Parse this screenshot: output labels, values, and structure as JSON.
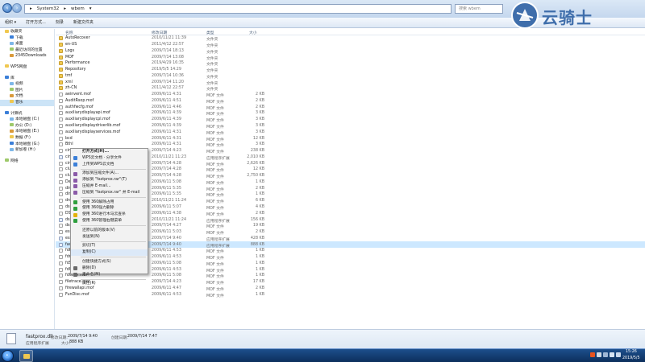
{
  "address": {
    "segments": [
      "System32",
      "wbem"
    ],
    "search_placeholder": "搜索 wbem"
  },
  "toolbar": {
    "items": [
      "组织 ▾",
      "打开方式...",
      "刻录",
      "新建文件夹"
    ]
  },
  "nav": {
    "favorites": [
      "收藏夹",
      "下载",
      "桌面",
      "最近访问的位置",
      "2345Downloads"
    ],
    "wps": "WPS网盘",
    "libraries": [
      "库",
      "视频",
      "图片",
      "文档",
      "音乐"
    ],
    "computer": [
      "计算机",
      "本地磁盘 (C:)",
      "办公 (D:)",
      "本地磁盘 (E:)",
      "数据 (F:)",
      "本地磁盘 (G:)",
      "新加卷 (H:)"
    ],
    "network": "网络",
    "selected_index": 10
  },
  "columns": {
    "name": "名称",
    "date": "修改日期",
    "type": "类型",
    "size": "大小"
  },
  "files": [
    {
      "name": "AutoRecover",
      "date": "2010/11/21 11:39",
      "type": "文件夹",
      "size": "",
      "kind": "folder"
    },
    {
      "name": "en-US",
      "date": "2011/4/12 22:57",
      "type": "文件夹",
      "size": "",
      "kind": "folder"
    },
    {
      "name": "Logs",
      "date": "2009/7/14 18:13",
      "type": "文件夹",
      "size": "",
      "kind": "folder"
    },
    {
      "name": "MOF",
      "date": "2009/7/14 13:08",
      "type": "文件夹",
      "size": "",
      "kind": "folder"
    },
    {
      "name": "Performance",
      "date": "2019/4/29 16:35",
      "type": "文件夹",
      "size": "",
      "kind": "folder"
    },
    {
      "name": "Repository",
      "date": "2019/5/5 14:29",
      "type": "文件夹",
      "size": "",
      "kind": "folder"
    },
    {
      "name": "tmf",
      "date": "2009/7/14 10:36",
      "type": "文件夹",
      "size": "",
      "kind": "folder"
    },
    {
      "name": "xml",
      "date": "2009/7/14 11:20",
      "type": "文件夹",
      "size": "",
      "kind": "folder"
    },
    {
      "name": "zh-CN",
      "date": "2011/4/12 22:57",
      "type": "文件夹",
      "size": "",
      "kind": "folder"
    },
    {
      "name": "aeinvent.mof",
      "date": "2009/6/11 4:31",
      "type": "MOF 文件",
      "size": "2 KB",
      "kind": "file"
    },
    {
      "name": "AuditRsop.mof",
      "date": "2009/6/11 4:51",
      "type": "MOF 文件",
      "size": "2 KB",
      "kind": "file"
    },
    {
      "name": "authfwcfg.mof",
      "date": "2009/6/11 4:46",
      "type": "MOF 文件",
      "size": "2 KB",
      "kind": "file"
    },
    {
      "name": "auxiliarydisplayapi.mof",
      "date": "2009/6/11 4:39",
      "type": "MOF 文件",
      "size": "3 KB",
      "kind": "file"
    },
    {
      "name": "auxiliarydisplaycpl.mof",
      "date": "2009/6/11 4:39",
      "type": "MOF 文件",
      "size": "3 KB",
      "kind": "file"
    },
    {
      "name": "auxiliarydisplaydriverlib.mof",
      "date": "2009/6/11 4:39",
      "type": "MOF 文件",
      "size": "3 KB",
      "kind": "file"
    },
    {
      "name": "auxiliarydisplayservices.mof",
      "date": "2009/6/11 4:31",
      "type": "MOF 文件",
      "size": "3 KB",
      "kind": "file"
    },
    {
      "name": "bcd",
      "date": "2009/6/11 4:31",
      "type": "MOF 文件",
      "size": "12 KB",
      "kind": "file"
    },
    {
      "name": "BthI",
      "date": "2009/6/11 4:31",
      "type": "MOF 文件",
      "size": "3 KB",
      "kind": "file"
    },
    {
      "name": "cim",
      "date": "2009/7/14 4:23",
      "type": "MOF 文件",
      "size": "238 KB",
      "kind": "file"
    },
    {
      "name": "cim",
      "date": "2010/11/21 11:23",
      "type": "应用程序扩展",
      "size": "2,010 KB",
      "kind": "dll"
    },
    {
      "name": "cim",
      "date": "2009/7/14 4:28",
      "type": "MOF 文件",
      "size": "2,626 KB",
      "kind": "file"
    },
    {
      "name": "clus",
      "date": "2009/7/14 4:28",
      "type": "MOF 文件",
      "size": "12 KB",
      "kind": "file"
    },
    {
      "name": "clus",
      "date": "2009/7/14 4:28",
      "type": "MOF 文件",
      "size": "2,750 KB",
      "kind": "file"
    },
    {
      "name": "Des",
      "date": "2009/6/11 5:08",
      "type": "MOF 文件",
      "size": "1 KB",
      "kind": "file"
    },
    {
      "name": "dim",
      "date": "2009/6/11 5:35",
      "type": "MOF 文件",
      "size": "2 KB",
      "kind": "file"
    },
    {
      "name": "dim",
      "date": "2009/6/11 5:35",
      "type": "MOF 文件",
      "size": "1 KB",
      "kind": "file"
    },
    {
      "name": "dnt",
      "date": "2010/11/21 11:24",
      "type": "MOF 文件",
      "size": "6 KB",
      "kind": "file"
    },
    {
      "name": "dsn",
      "date": "2009/6/11 5:07",
      "type": "MOF 文件",
      "size": "4 KB",
      "kind": "file"
    },
    {
      "name": "DSN",
      "date": "2009/6/11 4:38",
      "type": "MOF 文件",
      "size": "2 KB",
      "kind": "file"
    },
    {
      "name": "dsp",
      "date": "2010/11/21 11:24",
      "type": "应用程序扩展",
      "size": "156 KB",
      "kind": "dll"
    },
    {
      "name": "dsp",
      "date": "2009/7/14 4:27",
      "type": "MOF 文件",
      "size": "19 KB",
      "kind": "file"
    },
    {
      "name": "esm",
      "date": "2009/6/11 5:03",
      "type": "MOF 文件",
      "size": "2 KB",
      "kind": "file"
    },
    {
      "name": "esse",
      "date": "2009/7/14 9:40",
      "type": "应用程序扩展",
      "size": "428 KB",
      "kind": "dll"
    },
    {
      "name": "fastprox.dll",
      "date": "2009/7/14 9:40",
      "type": "应用程序扩展",
      "size": "888 KB",
      "kind": "dll"
    },
    {
      "name": "fdPHost.mof",
      "date": "2009/6/11 4:53",
      "type": "MOF 文件",
      "size": "1 KB",
      "kind": "file"
    },
    {
      "name": "fdrespub.mof",
      "date": "2009/6/11 4:53",
      "type": "MOF 文件",
      "size": "1 KB",
      "kind": "file"
    },
    {
      "name": "fdSSDP.mof",
      "date": "2009/6/11 5:08",
      "type": "MOF 文件",
      "size": "1 KB",
      "kind": "file"
    },
    {
      "name": "fdWNet.mof",
      "date": "2009/6/11 4:53",
      "type": "MOF 文件",
      "size": "1 KB",
      "kind": "file"
    },
    {
      "name": "fdWSD.mof",
      "date": "2009/6/11 5:08",
      "type": "MOF 文件",
      "size": "1 KB",
      "kind": "file"
    },
    {
      "name": "filetrace.mof",
      "date": "2009/7/14 4:23",
      "type": "MOF 文件",
      "size": "17 KB",
      "kind": "file"
    },
    {
      "name": "firewallapi.mof",
      "date": "2009/6/11 4:47",
      "type": "MOF 文件",
      "size": "2 KB",
      "kind": "file"
    },
    {
      "name": "FunDisc.mof",
      "date": "2009/6/11 4:53",
      "type": "MOF 文件",
      "size": "1 KB",
      "kind": "file"
    }
  ],
  "selected_file_index": 33,
  "context_menu": {
    "items": [
      {
        "label": "打开方式(H)...",
        "bold": true,
        "sep_after": false,
        "color": ""
      },
      {
        "label": "WPS云文档 · 分享文件",
        "bold": false,
        "sep_after": false,
        "color": "#3b7fd8"
      },
      {
        "label": "上传到WPS云文档",
        "bold": false,
        "sep_after": true,
        "color": "#3b7fd8"
      },
      {
        "label": "添加到压缩文件(A)...",
        "bold": false,
        "sep_after": false,
        "color": "#8a5aa8"
      },
      {
        "label": "添加到 \"fastprox.rar\"(T)",
        "bold": false,
        "sep_after": false,
        "color": "#8a5aa8"
      },
      {
        "label": "压缩并 E-mail...",
        "bold": false,
        "sep_after": false,
        "color": "#8a5aa8"
      },
      {
        "label": "压缩到 \"fastprox.rar\" 并 E-mail",
        "bold": false,
        "sep_after": true,
        "color": "#8a5aa8"
      },
      {
        "label": "使用 360解除占用",
        "bold": false,
        "sep_after": false,
        "color": "#2e9f3e"
      },
      {
        "label": "使用 360强力删除",
        "bold": false,
        "sep_after": false,
        "color": "#2e9f3e"
      },
      {
        "label": "使用 360进行木马云查杀",
        "bold": false,
        "sep_after": false,
        "color": "#e3b10a"
      },
      {
        "label": "使用 360管理右键菜单",
        "bold": false,
        "sep_after": true,
        "color": "#2e9f3e"
      },
      {
        "label": "还原以前的版本(V)",
        "bold": false,
        "sep_after": false,
        "color": ""
      },
      {
        "label": "发送到(N)",
        "bold": false,
        "sep_after": true,
        "color": ""
      },
      {
        "label": "剪切(T)",
        "bold": false,
        "sep_after": false,
        "color": ""
      },
      {
        "label": "复制(C)",
        "bold": false,
        "sep_after": true,
        "color": ""
      },
      {
        "label": "创建快捷方式(S)",
        "bold": false,
        "sep_after": false,
        "color": ""
      },
      {
        "label": "删除(D)",
        "bold": false,
        "sep_after": false,
        "color": "#6a6a6a"
      },
      {
        "label": "重命名(M)",
        "bold": false,
        "sep_after": true,
        "color": "#6a6a6a"
      },
      {
        "label": "属性(R)",
        "bold": false,
        "sep_after": false,
        "color": ""
      }
    ],
    "highlighted_index": 14
  },
  "details": {
    "name": "fastprox.dll",
    "modified_label": "修改日期:",
    "modified_value": "2009/7/14 9:40",
    "created_label": "创建日期:",
    "created_value": "2009/7/14 7:47",
    "type": "应用程序扩展",
    "size_label": "大小:",
    "size_value": "888 KB"
  },
  "taskbar": {
    "time": "15:26",
    "date": "2019/5/5"
  },
  "watermark": {
    "text": "云骑士"
  },
  "colors": {
    "accent": "#3f6eab",
    "selection": "#cde8ff",
    "taskbar": "#163f74"
  }
}
